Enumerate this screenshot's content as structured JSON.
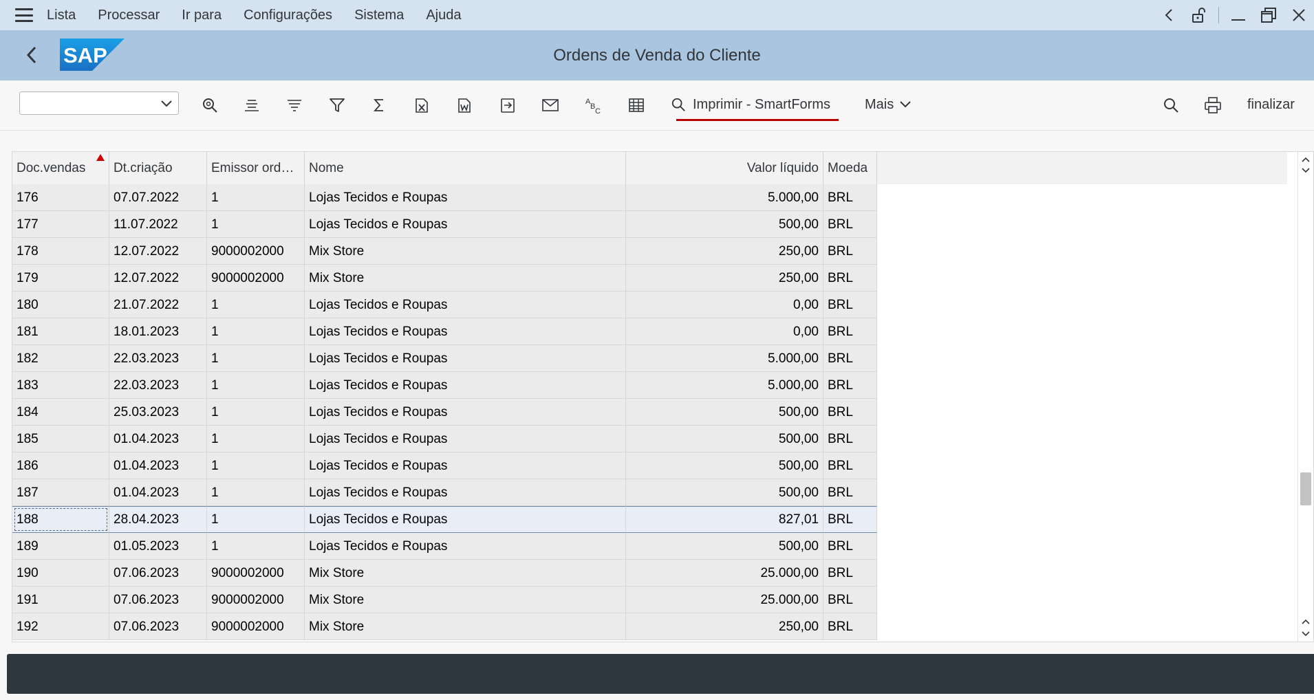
{
  "menu": {
    "items": [
      "Lista",
      "Processar",
      "Ir para",
      "Configurações",
      "Sistema",
      "Ajuda"
    ]
  },
  "window_controls": {
    "icons": [
      "chevron-left-icon",
      "unlock-icon",
      "minimize-icon",
      "restore-icon",
      "close-icon"
    ]
  },
  "header": {
    "logo_text": "SAP",
    "title": "Ordens de Venda do Cliente",
    "brand_color": "#1a73c7"
  },
  "toolbar": {
    "variant_value": "",
    "icons": [
      "search-icon",
      "align-center-icon",
      "sort-icon",
      "filter-icon",
      "sum-icon",
      "export-excel-icon",
      "export-word-icon",
      "export-file-icon",
      "mail-icon",
      "abc-icon",
      "layout-grid-icon"
    ],
    "print_smartforms_label": "Imprimir - SmartForms",
    "more_label": "Mais",
    "finalizar_label": "finalizar",
    "accent_color": "#bb0000"
  },
  "table": {
    "columns": [
      "Doc.vendas",
      "Dt.criação",
      "Emissor orde…",
      "Nome",
      "Valor líquido",
      "Moeda"
    ],
    "sorted_column": "Doc.vendas",
    "selected_row": "188",
    "rows": [
      [
        "176",
        "07.07.2022",
        "1",
        "Lojas Tecidos e Roupas",
        "5.000,00",
        "BRL"
      ],
      [
        "177",
        "11.07.2022",
        "1",
        "Lojas Tecidos e Roupas",
        "500,00",
        "BRL"
      ],
      [
        "178",
        "12.07.2022",
        "9000002000",
        "Mix Store",
        "250,00",
        "BRL"
      ],
      [
        "179",
        "12.07.2022",
        "9000002000",
        "Mix Store",
        "250,00",
        "BRL"
      ],
      [
        "180",
        "21.07.2022",
        "1",
        "Lojas Tecidos e Roupas",
        "0,00",
        "BRL"
      ],
      [
        "181",
        "18.01.2023",
        "1",
        "Lojas Tecidos e Roupas",
        "0,00",
        "BRL"
      ],
      [
        "182",
        "22.03.2023",
        "1",
        "Lojas Tecidos e Roupas",
        "5.000,00",
        "BRL"
      ],
      [
        "183",
        "22.03.2023",
        "1",
        "Lojas Tecidos e Roupas",
        "5.000,00",
        "BRL"
      ],
      [
        "184",
        "25.03.2023",
        "1",
        "Lojas Tecidos e Roupas",
        "500,00",
        "BRL"
      ],
      [
        "185",
        "01.04.2023",
        "1",
        "Lojas Tecidos e Roupas",
        "500,00",
        "BRL"
      ],
      [
        "186",
        "01.04.2023",
        "1",
        "Lojas Tecidos e Roupas",
        "500,00",
        "BRL"
      ],
      [
        "187",
        "01.04.2023",
        "1",
        "Lojas Tecidos e Roupas",
        "500,00",
        "BRL"
      ],
      [
        "188",
        "28.04.2023",
        "1",
        "Lojas Tecidos e Roupas",
        "827,01",
        "BRL"
      ],
      [
        "189",
        "01.05.2023",
        "1",
        "Lojas Tecidos e Roupas",
        "500,00",
        "BRL"
      ],
      [
        "190",
        "07.06.2023",
        "9000002000",
        "Mix Store",
        "25.000,00",
        "BRL"
      ],
      [
        "191",
        "07.06.2023",
        "9000002000",
        "Mix Store",
        "25.000,00",
        "BRL"
      ],
      [
        "192",
        "07.06.2023",
        "9000002000",
        "Mix Store",
        "250,00",
        "BRL"
      ]
    ]
  },
  "statusbar": {
    "text": ""
  }
}
